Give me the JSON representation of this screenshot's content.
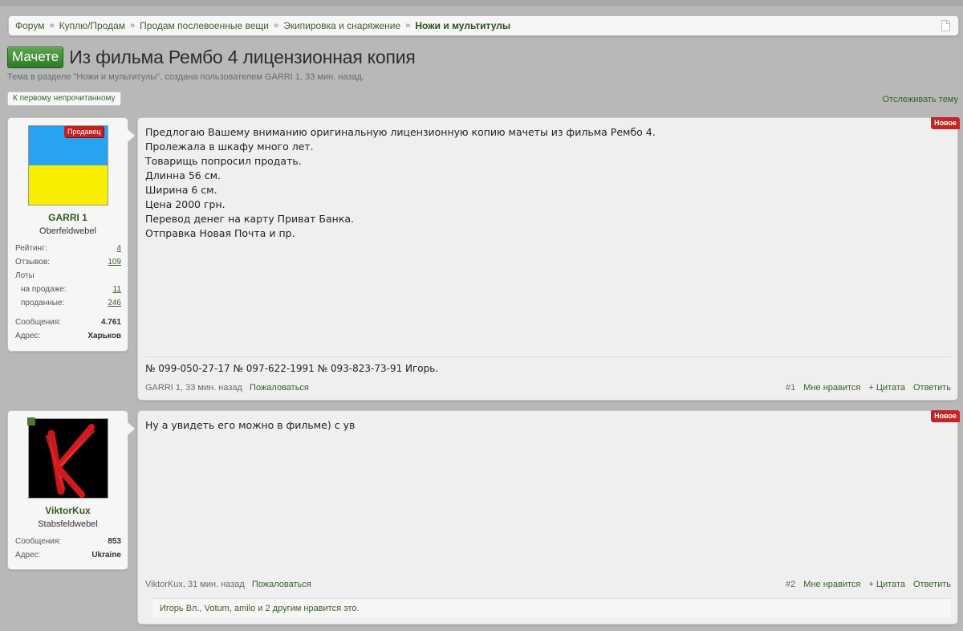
{
  "breadcrumb": {
    "items": [
      "Форум",
      "Куплю/Продам",
      "Продам послевоенные вещи",
      "Экипировка и снаряжение"
    ],
    "current": "Ножи и мультитулы",
    "separator": "»"
  },
  "thread": {
    "prefix": "Мачете",
    "title": "Из фильма Рембо 4 лицензионная копия",
    "subtitle": "Тема в разделе \"Ножи и мультитулы\", создана пользователем GARRI 1, 33 мин. назад."
  },
  "controls": {
    "first_unread": "К первому непрочитанному",
    "watch": "Отслеживать тему"
  },
  "posts": [
    {
      "badge": "Новое",
      "user": {
        "seller_badge": "Продавец",
        "name": "GARRI 1",
        "title": "Oberfeldwebel",
        "stats": [
          {
            "label": "Рейтинг:",
            "value": "4"
          },
          {
            "label": "Отзывов:",
            "value": "109"
          },
          {
            "label": "Лоты",
            "value": ""
          },
          {
            "label": "на продаже:",
            "value": "11"
          },
          {
            "label": "проданные:",
            "value": "246"
          },
          {
            "label": "Сообщения:",
            "value": "4.761"
          },
          {
            "label": "Адрес:",
            "value": "Харьков"
          }
        ]
      },
      "message": "Предлогаю Вашему вниманию оригинальную лицензионную копию мачеты из фильма Рембо 4.\nПролежала в шкафу много лет.\nТоварищь попросил продать.\nДлинна 56 см.\nШирина 6 см.\nЦена 2000 грн.\nПеревод денег на карту Приват Банка.\nОтправка Новая Почта и пр.",
      "signature": "№ 099-050-27-17 № 097-622-1991 № 093-823-73-91 Игорь.",
      "meta": {
        "author_time": "GARRI 1, 33 мин. назад",
        "report": "Пожаловаться",
        "number": "#1",
        "like": "Мне нравится",
        "quote": "+ Цитата",
        "reply": "Ответить"
      }
    },
    {
      "badge": "Новое",
      "user": {
        "name": "ViktorKux",
        "title": "Stabsfeldwebel",
        "stats": [
          {
            "label": "Сообщения:",
            "value": "853"
          },
          {
            "label": "Адрес:",
            "value": "Ukraine"
          }
        ]
      },
      "message": "Ну а увидеть его можно в фильме) с ув",
      "meta": {
        "author_time": "ViktorKux, 31 мин. назад",
        "report": "Пожаловаться",
        "number": "#2",
        "like": "Мне нравится",
        "quote": "+ Цитата",
        "reply": "Ответить"
      },
      "likes": {
        "users": [
          "Игорь Вл.",
          "Votum",
          "amilo"
        ],
        "rest": "и 2 другим нравится это."
      }
    }
  ],
  "colors": {
    "accent_green": "#3d5e2b",
    "badge_red": "#c42424",
    "flag_blue": "#29a3f0",
    "flag_yellow": "#f7ee00"
  },
  "icons": {
    "breadcrumb_end": "page-icon",
    "post2_status": "online-indicator"
  }
}
